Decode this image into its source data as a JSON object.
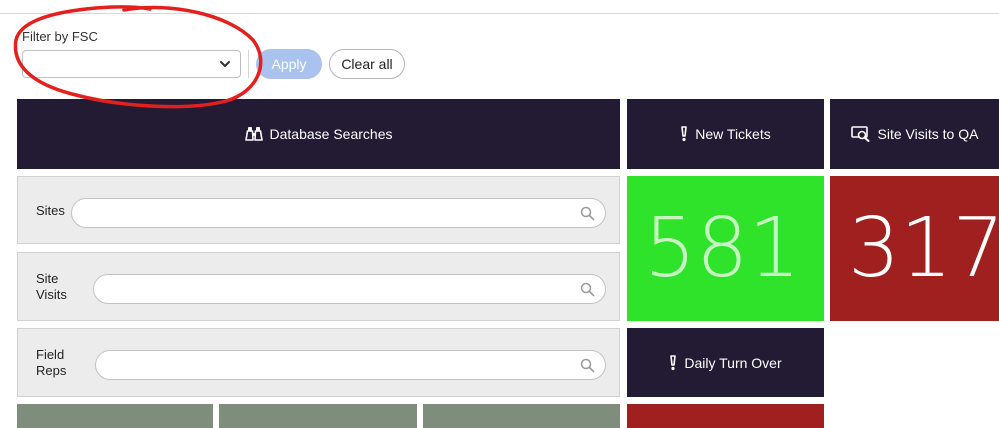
{
  "filter": {
    "label": "Filter by FSC",
    "select_value": "",
    "apply_label": "Apply",
    "clear_label": "Clear all"
  },
  "panels": {
    "database_searches": {
      "title": "Database Searches",
      "icon": "binoculars-icon"
    },
    "new_tickets": {
      "title": "New Tickets",
      "icon": "exclamation-icon",
      "value": "581"
    },
    "site_visits_qa": {
      "title": "Site Visits to QA",
      "icon": "site-visit-icon",
      "value": "317"
    },
    "daily_turn_over": {
      "title": "Daily Turn Over",
      "icon": "exclamation-icon"
    }
  },
  "search_rows": [
    {
      "label": "Sites",
      "value": ""
    },
    {
      "label": "Site Visits",
      "value": ""
    },
    {
      "label": "Field Reps",
      "value": ""
    }
  ],
  "colors": {
    "header_bg": "#221b33",
    "tile_green": "#2fe32b",
    "tile_red": "#a0201f",
    "apply_bg": "#a9c2ee",
    "annotation": "#e4201f"
  }
}
